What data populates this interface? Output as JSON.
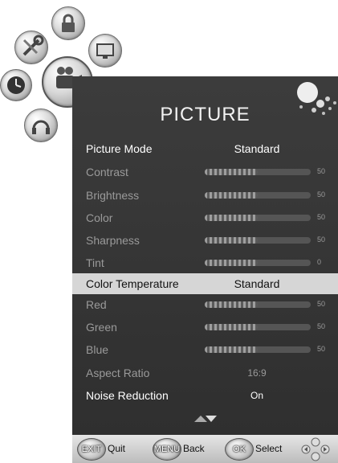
{
  "menu_icons": [
    {
      "name": "lock-icon"
    },
    {
      "name": "setup-tools-icon"
    },
    {
      "name": "screen-icon"
    },
    {
      "name": "camcorder-picture-icon",
      "selected": true
    },
    {
      "name": "clock-icon"
    },
    {
      "name": "audio-icon"
    }
  ],
  "panel": {
    "title": "PICTURE",
    "rows": [
      {
        "label": "Picture Mode",
        "value": "Standard"
      },
      {
        "label": "Contrast",
        "level": 50,
        "display": "50"
      },
      {
        "label": "Brightness",
        "level": 50,
        "display": "50"
      },
      {
        "label": "Color",
        "level": 50,
        "display": "50"
      },
      {
        "label": "Sharpness",
        "level": 50,
        "display": "50"
      },
      {
        "label": "Tint",
        "level": 50,
        "display": "0"
      },
      {
        "label": "Color Temperature",
        "value": "Standard"
      },
      {
        "label": "Red",
        "level": 50,
        "display": "50"
      },
      {
        "label": "Green",
        "level": 50,
        "display": "50"
      },
      {
        "label": "Blue",
        "level": 50,
        "display": "50"
      },
      {
        "label": "Aspect Ratio",
        "value": "16:9"
      },
      {
        "label": "Noise Reduction",
        "value": "On"
      }
    ]
  },
  "footer": {
    "exit_key": "EXIT",
    "exit_label": "Quit",
    "menu_key": "MENU",
    "menu_label": "Back",
    "ok_key": "OK",
    "ok_label": "Select"
  },
  "colors": {
    "panel_bg": "#353535",
    "highlight": "#d6d6d6",
    "text_dim": "#9a9a9a",
    "text_active": "#ffffff"
  }
}
